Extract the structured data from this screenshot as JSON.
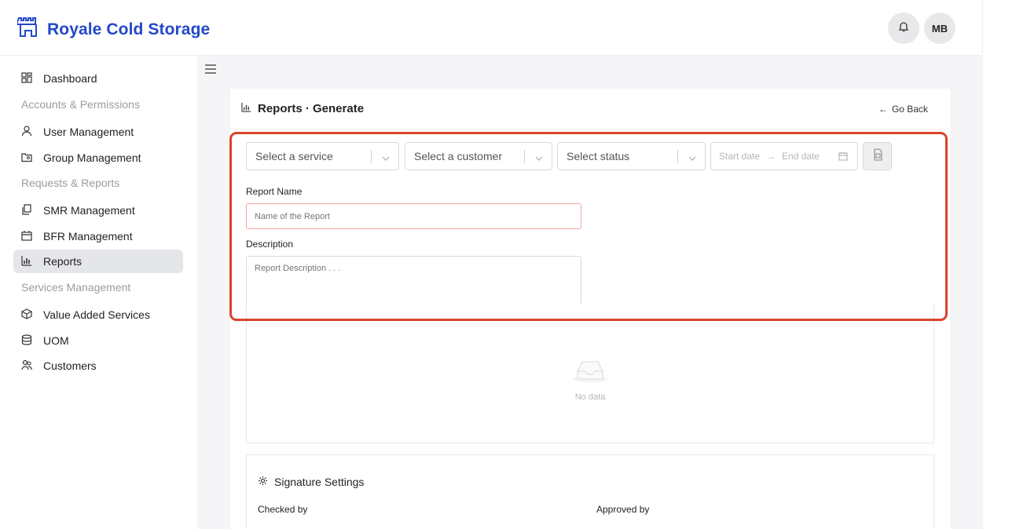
{
  "header": {
    "brand_name": "Royale Cold Storage",
    "avatar_initials": "MB",
    "brand_color": "#2349c8"
  },
  "sidebar": {
    "items": [
      {
        "label": "Dashboard",
        "icon": "dashboard-icon"
      },
      {
        "label": "Accounts & Permissions",
        "group": true
      },
      {
        "label": "User Management",
        "icon": "user-icon"
      },
      {
        "label": "Group Management",
        "icon": "folder-group-icon"
      },
      {
        "label": "Requests & Reports",
        "group": true
      },
      {
        "label": "SMR Management",
        "icon": "copy-icon"
      },
      {
        "label": "BFR Management",
        "icon": "box-icon"
      },
      {
        "label": "Reports",
        "icon": "bar-chart-icon",
        "active": true
      },
      {
        "label": "Services Management",
        "group": true
      },
      {
        "label": "Value Added Services",
        "icon": "cube-icon"
      },
      {
        "label": "UOM",
        "icon": "database-icon"
      },
      {
        "label": "Customers",
        "icon": "team-icon"
      }
    ]
  },
  "page": {
    "title": "Reports · Generate",
    "go_back": "Go Back"
  },
  "filters": {
    "service_placeholder": "Select a service",
    "customer_placeholder": "Select a customer",
    "status_placeholder": "Select status",
    "start_date_placeholder": "Start date",
    "end_date_placeholder": "End date"
  },
  "form": {
    "report_name_label": "Report Name",
    "report_name_placeholder": "Name of the Report",
    "description_label": "Description",
    "description_placeholder": "Report Description . . ."
  },
  "table": {
    "empty_text": "No data"
  },
  "signature": {
    "title": "Signature Settings",
    "checked_by_label": "Checked by",
    "approved_by_label": "Approved by"
  },
  "highlight_color": "#d8432c"
}
